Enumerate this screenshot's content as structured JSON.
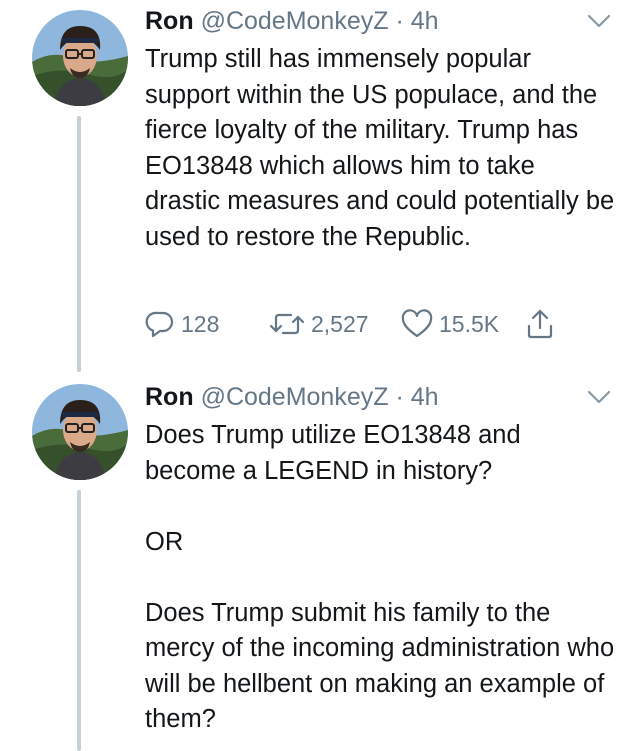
{
  "tweets": [
    {
      "name": "Ron",
      "handle": "@CodeMonkeyZ",
      "separator": "·",
      "time": "4h",
      "paragraphs": [
        "Trump still has immensely popular support within the US populace, and the fierce loyalty of the military. Trump has EO13848 which allows him to take drastic measures and could potentially be used to restore the Republic."
      ],
      "replies": "128",
      "retweets": "2,527",
      "likes": "15.5K"
    },
    {
      "name": "Ron",
      "handle": "@CodeMonkeyZ",
      "separator": "·",
      "time": "4h",
      "paragraphs": [
        "Does Trump utilize EO13848 and become a LEGEND in history?",
        "OR",
        "Does Trump submit his family to the mercy of the incoming administration who will be hellbent on making an example of them?"
      ]
    }
  ],
  "icons": {
    "reply": "reply-icon",
    "retweet": "retweet-icon",
    "like": "heart-icon",
    "share": "share-icon",
    "more": "chevron-down-icon"
  },
  "colors": {
    "text": "#14171a",
    "secondary": "#657786",
    "thread_line": "#c4cfd6"
  }
}
